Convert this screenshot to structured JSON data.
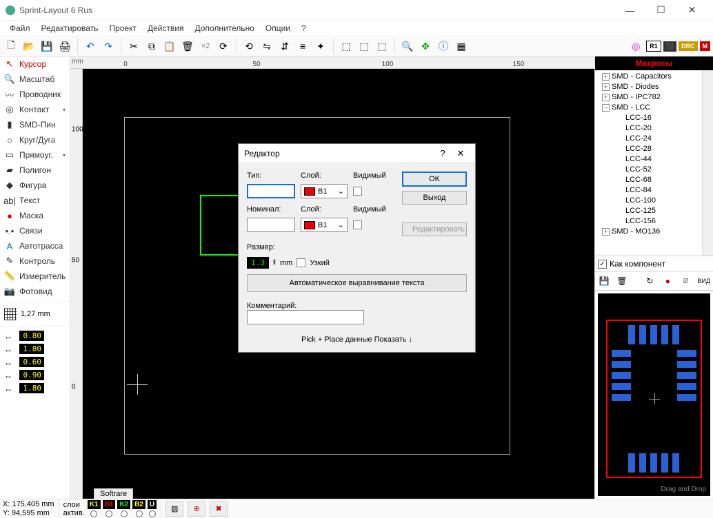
{
  "title": "Sprint-Layout 6 Rus",
  "menu": [
    "Файл",
    "Редактировать",
    "Проект",
    "Действия",
    "Дополнительно",
    "Опции",
    "?"
  ],
  "ruler_unit": "mm",
  "ruler_h": [
    "0",
    "50",
    "100",
    "150"
  ],
  "ruler_v": [
    "100",
    "50",
    "0"
  ],
  "canvas_tab": "Softrare",
  "tools": [
    {
      "icon": "↖",
      "label": "Курсор",
      "active": true
    },
    {
      "icon": "🔍",
      "label": "Масштаб"
    },
    {
      "icon": "〰",
      "label": "Проводник"
    },
    {
      "icon": "◎",
      "label": "Контакт",
      "drop": true
    },
    {
      "icon": "▮",
      "label": "SMD-Пин"
    },
    {
      "icon": "○",
      "label": "Круг/Дуга"
    },
    {
      "icon": "▭",
      "label": "Прямоуг.",
      "drop": true
    },
    {
      "icon": "▰",
      "label": "Полигон"
    },
    {
      "icon": "◆",
      "label": "Фигура"
    },
    {
      "icon": "ab|",
      "label": "Текст"
    },
    {
      "icon": "●",
      "label": "Маска",
      "red": true
    },
    {
      "icon": "•.•",
      "label": "Связи"
    },
    {
      "icon": "A",
      "label": "Автотрасса",
      "blue": true
    },
    {
      "icon": "✎",
      "label": "Контроль"
    },
    {
      "icon": "📏",
      "label": "Измеритель"
    },
    {
      "icon": "📷",
      "label": "Фотовид"
    }
  ],
  "grid_label": "1,27 mm",
  "params": [
    {
      "v": "0.80"
    },
    {
      "v": "1.80"
    },
    {
      "v": "0.60"
    },
    {
      "v": "0.90"
    },
    {
      "v": "1.80"
    }
  ],
  "dialog": {
    "title": "Редактор",
    "type_lbl": "Тип:",
    "layer_lbl": "Слой:",
    "visible_lbl": "Видимый",
    "layer_val": "B1",
    "nominal_lbl": "Номинал:",
    "ok": "OK",
    "exit": "Выход",
    "edit": "Редактировать",
    "size_lbl": "Размер:",
    "size_val": "1.3",
    "size_unit": "mm",
    "narrow": "Узкий",
    "auto_align": "Автоматическое выравнивание текста",
    "comment_lbl": "Комментарий:",
    "pick": "Pick + Place данные Показать  ↓"
  },
  "macros_title": "Макросы",
  "tree": [
    {
      "d": 0,
      "exp": "+",
      "t": "SMD - Capacitors"
    },
    {
      "d": 0,
      "exp": "+",
      "t": "SMD - Diodes"
    },
    {
      "d": 0,
      "exp": "+",
      "t": "SMD - IPC782"
    },
    {
      "d": 0,
      "exp": "−",
      "t": "SMD - LCC"
    },
    {
      "d": 1,
      "t": "LCC-16"
    },
    {
      "d": 1,
      "t": "LCC-20"
    },
    {
      "d": 1,
      "t": "LCC-24"
    },
    {
      "d": 1,
      "t": "LCC-28"
    },
    {
      "d": 1,
      "t": "LCC-44"
    },
    {
      "d": 1,
      "t": "LCC-52"
    },
    {
      "d": 1,
      "t": "LCC-68"
    },
    {
      "d": 1,
      "t": "LCC-84"
    },
    {
      "d": 1,
      "t": "LCC-100"
    },
    {
      "d": 1,
      "t": "LCC-125"
    },
    {
      "d": 1,
      "t": "LCC-156"
    },
    {
      "d": 0,
      "exp": "+",
      "t": "SMD - MO136"
    }
  ],
  "as_component": "Как компонент",
  "drag_drop": "Drag and Drop",
  "view_lbl": "ВИД",
  "coord": {
    "x": "X:  175,405 mm",
    "y": "Y:   94,595 mm"
  },
  "layers": {
    "label": "слои",
    "active": "актив.",
    "items": [
      "K1",
      "B1",
      "K2",
      "B2",
      "U"
    ],
    "colors": [
      "#ff0",
      "#f00",
      "#0f0",
      "#ff0",
      "#fff"
    ]
  }
}
